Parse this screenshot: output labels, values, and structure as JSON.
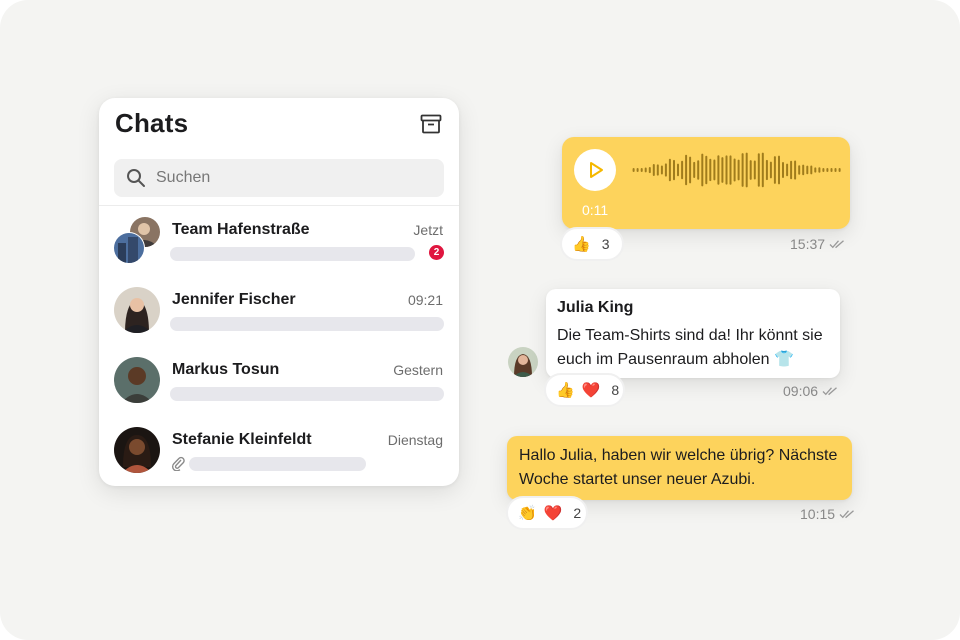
{
  "chat_list": {
    "title": "Chats",
    "archive_icon": "archive-icon",
    "search": {
      "placeholder": "Suchen",
      "value": ""
    },
    "items": [
      {
        "name": "Team Hafenstraße",
        "time": "Jetzt",
        "unread": "2",
        "avatar": "group-avatar"
      },
      {
        "name": "Jennifer Fischer",
        "time": "09:21",
        "avatar": "person-avatar"
      },
      {
        "name": "Markus Tosun",
        "time": "Gestern",
        "avatar": "person-avatar"
      },
      {
        "name": "Stefanie Kleinfeldt",
        "time": "Dienstag",
        "avatar": "person-avatar",
        "attachment_icon": "paperclip-icon"
      }
    ]
  },
  "messages": {
    "voice": {
      "duration": "0:11",
      "time": "15:37",
      "reactions": {
        "emojis": [
          "👍"
        ],
        "count": "3"
      }
    },
    "incoming": {
      "sender": "Julia King",
      "text": "Die Team-Shirts sind da! Ihr könnt sie euch im Pausenraum abholen 👕",
      "time": "09:06",
      "reactions": {
        "emojis": [
          "👍",
          "❤️"
        ],
        "count": "8"
      }
    },
    "outgoing": {
      "text": "Hallo Julia, haben wir welche übrig? Nächste Woche startet unser neuer Azubi.",
      "time": "10:15",
      "reactions": {
        "emojis": [
          "👏",
          "❤️"
        ],
        "count": "2"
      }
    }
  },
  "colors": {
    "accent_yellow": "#fdd35c",
    "unread_badge": "#e0163f",
    "background": "#f4f4f2"
  }
}
